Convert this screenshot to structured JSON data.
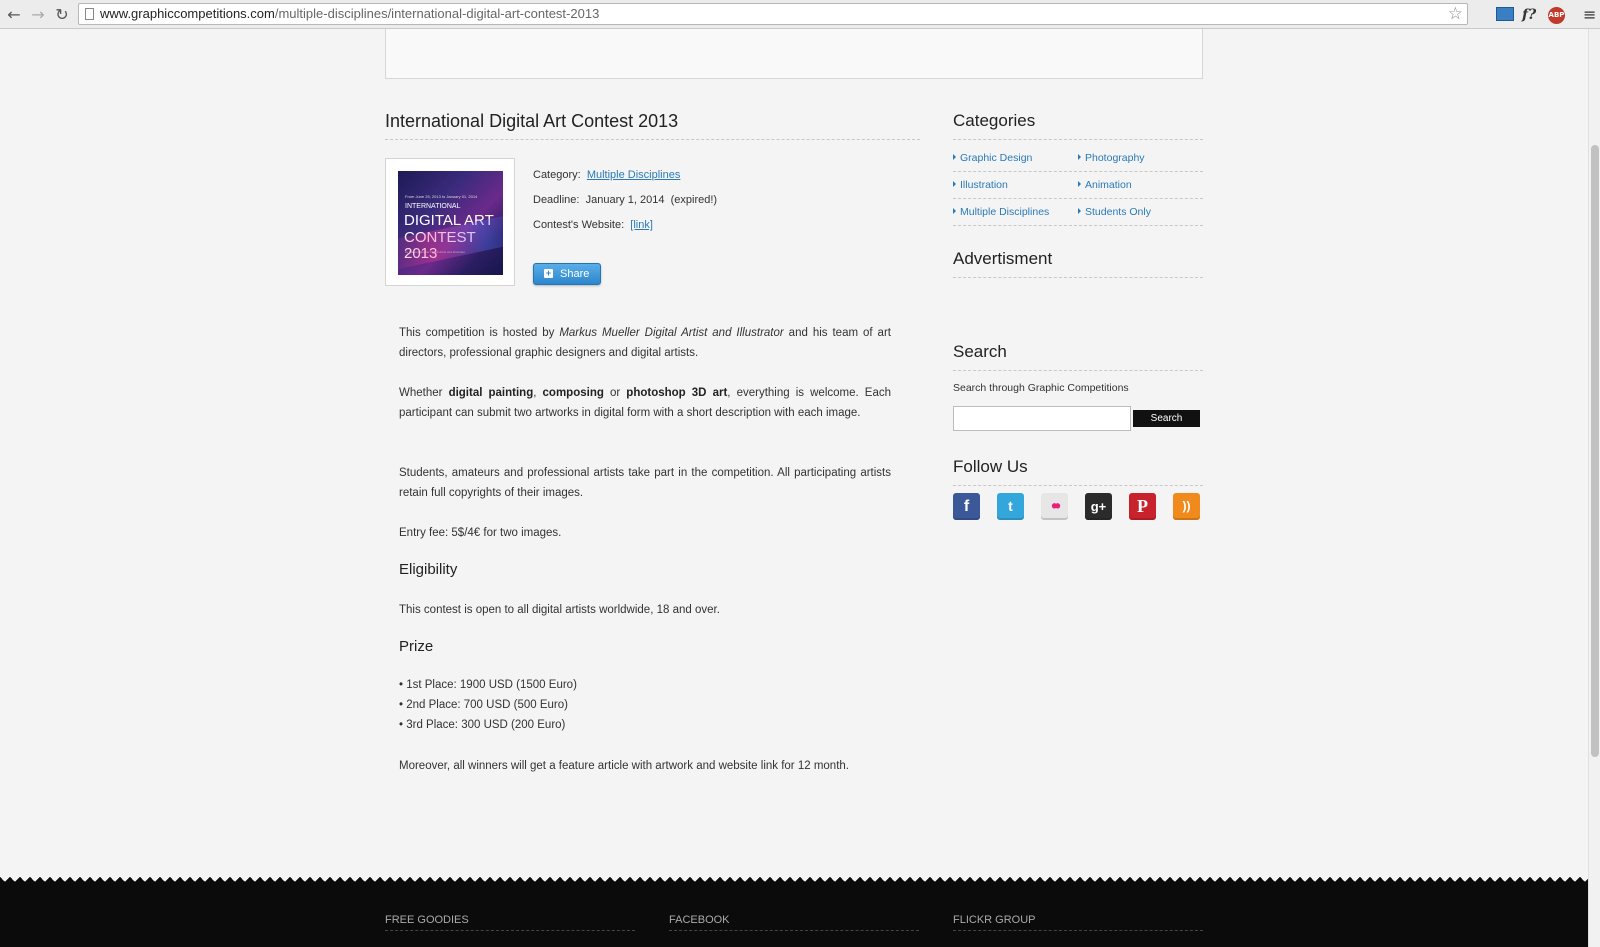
{
  "browser": {
    "url_host": "www.graphiccompetitions.com",
    "url_path": "/multiple-disciplines/international-digital-art-contest-2013",
    "back_glyph": "←",
    "forward_glyph": "→",
    "reload_glyph": "↻",
    "star_glyph": "☆",
    "ext_f": "f?",
    "ext_abp": "ABP",
    "menu_glyph": "≡"
  },
  "article": {
    "title": "International Digital Art Contest 2013",
    "poster": {
      "date_line": "From June 25, 2013 to January 01, 2014",
      "line1": "INTERNATIONAL",
      "line2": "DIGITAL ART",
      "line3": "CONTEST 2013",
      "sub": "by Markus Mueller Digital Artist and Illustrator"
    },
    "meta": {
      "category_label": "Category:",
      "category_value": "Multiple Disciplines",
      "deadline_label": "Deadline:",
      "deadline_value": "January 1, 2014",
      "deadline_status": "(expired!)",
      "website_label": "Contest's Website:",
      "website_link": "[link]"
    },
    "share_label": "Share",
    "p1_a": "This competition is hosted by ",
    "p1_em": "Markus Mueller Digital Artist and Illustrator",
    "p1_b": " and his team of art directors, professional graphic designers and digital artists.",
    "p2_a": "Whether ",
    "p2_b1": "digital painting",
    "p2_c": ", ",
    "p2_b2": "composing",
    "p2_d": " or ",
    "p2_b3": "photoshop 3D art",
    "p2_e": ", everything is welcome. Each participant can submit two artworks in digital form with a short description with each image.",
    "p3": "Students, amateurs and professional artists take part in the competition. All participating artists retain full copyrights of their images.",
    "p4": "Entry fee: 5$/4€ for two images.",
    "eligibility_head": "Eligibility",
    "eligibility_text": "This contest is open to all digital artists worldwide, 18 and over.",
    "prize_head": "Prize",
    "prizes": [
      "• 1st Place: 1900 USD (1500 Euro)",
      "• 2nd Place: 700 USD (500 Euro)",
      "• 3rd Place: 300 USD (200 Euro)"
    ],
    "closing": "Moreover, all winners will get a feature article with artwork and website link for 12 month."
  },
  "sidebar": {
    "categories_head": "Categories",
    "categories": [
      "Graphic Design",
      "Photography",
      "Illustration",
      "Animation",
      "Multiple Disciplines",
      "Students Only"
    ],
    "ad_head": "Advertisment",
    "search_head": "Search",
    "search_desc": "Search through Graphic Competitions",
    "search_input_value": "",
    "search_button": "Search",
    "follow_head": "Follow Us",
    "social": [
      {
        "name": "facebook",
        "glyph": "f",
        "color": "#3b5998"
      },
      {
        "name": "twitter",
        "glyph": "t",
        "color": "#33a7dc"
      },
      {
        "name": "flickr",
        "glyph": "••",
        "color": "#e6e6e6"
      },
      {
        "name": "google-plus",
        "glyph": "g+",
        "color": "#2b2b2b"
      },
      {
        "name": "pinterest",
        "glyph": "P",
        "color": "#c8232c"
      },
      {
        "name": "rss",
        "glyph": "))",
        "color": "#f08a1d"
      }
    ]
  },
  "footer": {
    "col1": "FREE GOODIES",
    "col2": "FACEBOOK",
    "col3": "FLICKR GROUP"
  }
}
